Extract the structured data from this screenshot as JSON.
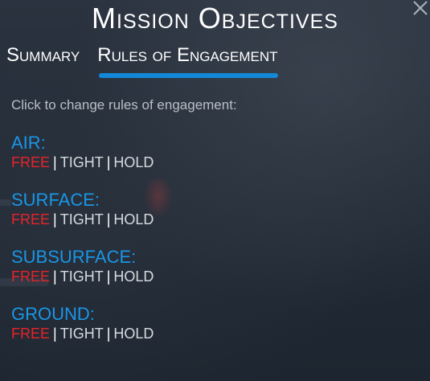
{
  "title": "Mission Objectives",
  "tabs": [
    {
      "label": "Summary",
      "active": false
    },
    {
      "label": "Rules of Engagement",
      "active": true
    }
  ],
  "hint": "Click to change rules of engagement:",
  "sections": [
    {
      "title": "AIR:",
      "options": [
        "FREE",
        "TIGHT",
        "HOLD"
      ],
      "selected": "FREE"
    },
    {
      "title": "SURFACE:",
      "options": [
        "FREE",
        "TIGHT",
        "HOLD"
      ],
      "selected": "FREE"
    },
    {
      "title": "SUBSURFACE:",
      "options": [
        "FREE",
        "TIGHT",
        "HOLD"
      ],
      "selected": "FREE"
    },
    {
      "title": "GROUND:",
      "options": [
        "FREE",
        "TIGHT",
        "HOLD"
      ],
      "selected": "FREE"
    }
  ],
  "separator": "|",
  "colors": {
    "accent": "#1388d8",
    "section_title": "#1a96e6",
    "selected_option": "#e8242a",
    "option": "#d8dbe0"
  },
  "icons": {
    "close": "close-icon"
  }
}
